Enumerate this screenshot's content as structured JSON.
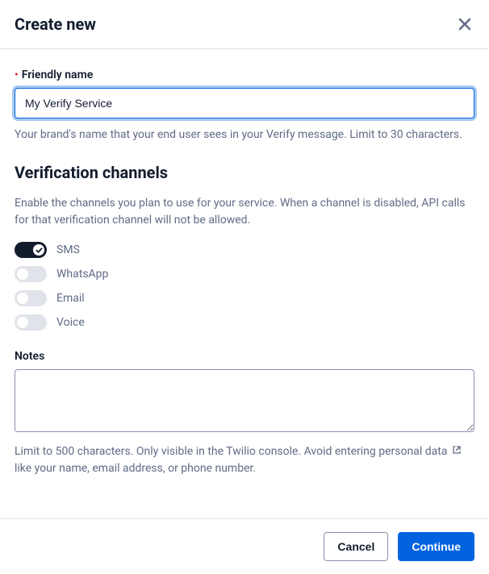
{
  "header": {
    "title": "Create new"
  },
  "friendlyName": {
    "label": "Friendly name",
    "value": "My Verify Service",
    "help": "Your brand's name that your end user sees in your Verify message. Limit to 30 characters."
  },
  "channelsSection": {
    "title": "Verification channels",
    "description": "Enable the channels you plan to use for your service. When a channel is disabled, API calls for that verification channel will not be allowed."
  },
  "channels": [
    {
      "label": "SMS",
      "enabled": true
    },
    {
      "label": "WhatsApp",
      "enabled": false
    },
    {
      "label": "Email",
      "enabled": false
    },
    {
      "label": "Voice",
      "enabled": false
    }
  ],
  "notes": {
    "label": "Notes",
    "value": "",
    "helpBefore": "Limit to 500 characters. Only visible in the Twilio console. Avoid entering personal data",
    "helpAfter": " like your name, email address, or phone number."
  },
  "footer": {
    "cancel": "Cancel",
    "continue": "Continue"
  }
}
